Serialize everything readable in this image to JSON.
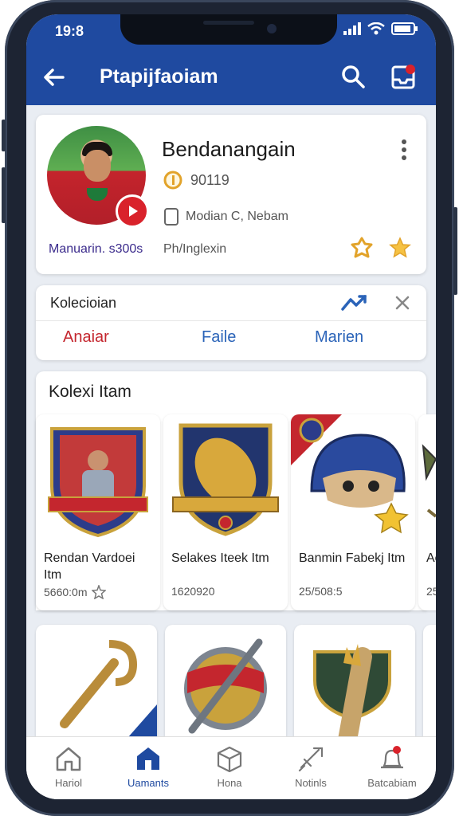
{
  "status_bar": {
    "time": "19:8"
  },
  "app_bar": {
    "title": "Ptapijfaoiam",
    "icons": [
      "back-arrow-icon",
      "search-icon",
      "inbox-icon"
    ]
  },
  "profile": {
    "name": "Bendanangain",
    "coins": "90119",
    "location": "Modian C, Nebam",
    "member_label": "Manuarin. s300s",
    "sub_label": "Ph/Inglexin",
    "icons": [
      "play-icon",
      "more-icon",
      "coin-icon",
      "device-icon",
      "award-icon",
      "star-icon"
    ]
  },
  "collection": {
    "title": "Kolecioian",
    "tabs": [
      "Anaiar",
      "Faile",
      "Marien"
    ],
    "icons": [
      "trend-icon",
      "close-icon"
    ]
  },
  "items_section": {
    "title": "Kolexi Itam",
    "items": [
      {
        "name": "Rendan Vardoei Itm",
        "meta": "5660:0m"
      },
      {
        "name": "Selakes Iteek Itm",
        "meta": "1620920"
      },
      {
        "name": "Banmin Fabekj Itm",
        "meta": "25/508:5"
      },
      {
        "name": "Ac",
        "meta": "25"
      }
    ]
  },
  "bottom_nav": {
    "items": [
      {
        "label": "Hariol",
        "icon": "home-icon"
      },
      {
        "label": "Uamants",
        "icon": "store-icon",
        "active": true
      },
      {
        "label": "Hona",
        "icon": "box-icon"
      },
      {
        "label": "Notinls",
        "icon": "sword-icon"
      },
      {
        "label": "Batcabiam",
        "icon": "bell-icon"
      }
    ]
  },
  "colors": {
    "primary": "#1f4aa0",
    "accent_red": "#c4262e",
    "gold": "#e2a32a"
  }
}
